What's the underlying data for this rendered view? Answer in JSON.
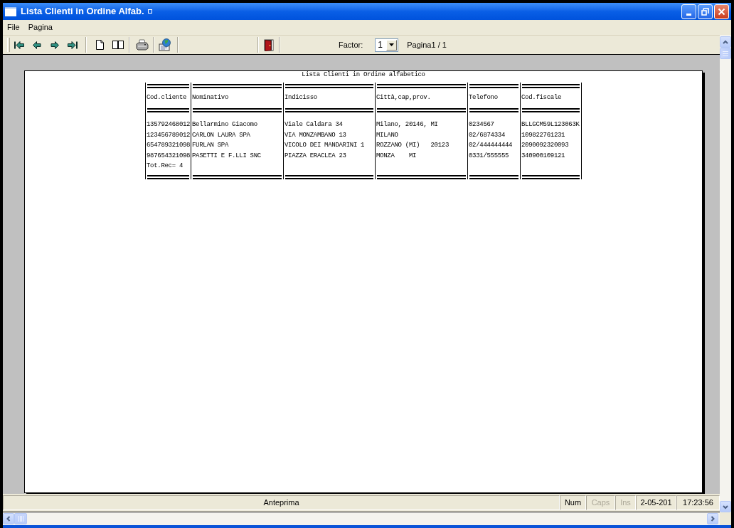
{
  "window": {
    "title": "Lista Clienti in Ordine Alfab."
  },
  "menu": [
    "File",
    "Pagina"
  ],
  "toolbar": {
    "factor_label": "Factor:",
    "factor_value": "1",
    "page_indicator": "Pagina1 / 1"
  },
  "report": {
    "title": "Lista Clienti in Ordine alfabetico",
    "table": {
      "columns": [
        "Cod.cliente",
        "Nominativo",
        "Indicisso",
        "Città,cap,prov.",
        "Telefono",
        "Cod.fiscale"
      ],
      "rows": [
        [
          "135792468012",
          "Bellarmino Giacomo",
          "Viale Caldara 34",
          "Milano, 20146, MI",
          "0234567",
          "BLLGCM59L123063K"
        ],
        [
          "123456789012",
          "CARLON LAURA SPA",
          "VIA MONZAMBANO 13",
          "MILANO",
          "02/6874334",
          "109822761231"
        ],
        [
          "654789321098",
          "FURLAN SPA",
          "VICOLO DEI MANDARINI 1",
          "ROZZANO (MI)   20123",
          "02/444444444",
          "2090092320093"
        ],
        [
          "987654321098",
          "PASETTI E F.LLI SNC",
          "PIAZZA ERACLEA 23",
          "MONZA    MI",
          "0331/555555",
          "340900109121"
        ]
      ],
      "footer": "Tot.Rec= 4"
    }
  },
  "status_bar": {
    "message": "Anteprima",
    "indicators": [
      {
        "label": "Num",
        "active": true
      },
      {
        "label": "Caps",
        "active": false
      },
      {
        "label": "Ins",
        "active": false
      }
    ],
    "date": "2-05-201",
    "time": "17:23:56"
  }
}
